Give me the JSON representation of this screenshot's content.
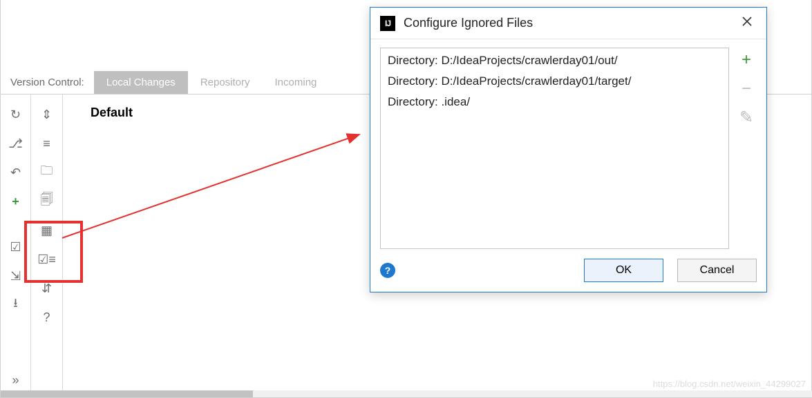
{
  "panel": {
    "label": "Version Control:",
    "tabs": [
      {
        "label": "Local Changes",
        "active": true
      },
      {
        "label": "Repository",
        "active": false
      },
      {
        "label": "Incoming",
        "active": false
      }
    ],
    "default_label": "Default"
  },
  "gutter1": {
    "refresh": "↻",
    "branch": "⎇",
    "undo": "↶",
    "plus": "+",
    "checkbox": "☑",
    "import": "⇲",
    "download": "⭳",
    "more": "»"
  },
  "gutter2": {
    "collapse": "⇕",
    "expand": "≡",
    "folder": "🗀",
    "copy": "🗐",
    "grid": "▦",
    "checklist": "☑≡",
    "transfer": "⇵",
    "help": "?"
  },
  "dialog": {
    "title": "Configure Ignored Files",
    "rows": [
      "Directory: D:/IdeaProjects/crawlerday01/out/",
      "Directory: D:/IdeaProjects/crawlerday01/target/",
      "Directory: .idea/"
    ],
    "add": "+",
    "remove": "−",
    "edit": "✎",
    "help": "?",
    "ok": "OK",
    "cancel": "Cancel",
    "app_icon": "IJ"
  },
  "watermark": "https://blog.csdn.net/weixin_44299027"
}
